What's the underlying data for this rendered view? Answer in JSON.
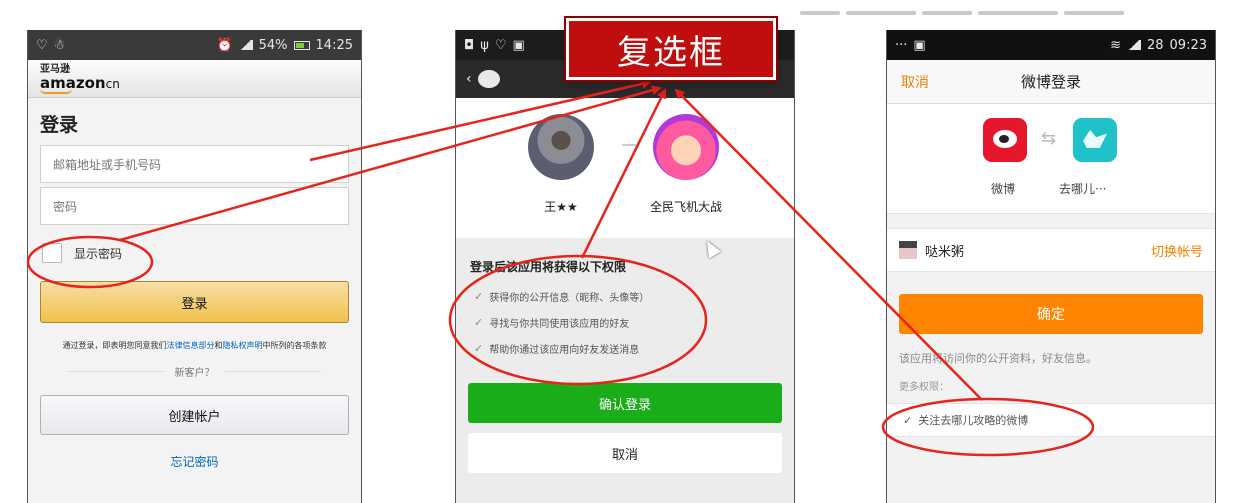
{
  "annotation": {
    "label": "复选框",
    "color": "#d00000"
  },
  "phone1": {
    "status": {
      "time": "14:25",
      "battery": "54%"
    },
    "brand": {
      "cn": "亚马逊",
      "logo": "amazon",
      "logo_suffix": "cn"
    },
    "title": "登录",
    "email_placeholder": "邮箱地址或手机号码",
    "password_placeholder": "密码",
    "show_password": "显示密码",
    "login_button": "登录",
    "terms_before": "通过登录，即表明您同意我们",
    "terms_link1": "法律信息部分",
    "terms_mid": "和",
    "terms_link2": "隐私权声明",
    "terms_after": "中所列的各项条款",
    "new_customer": "新客户？",
    "create_account": "创建帐户",
    "forgot_password": "忘记密码"
  },
  "phone2": {
    "user_name": "王★★",
    "app_name": "全民飞机大战",
    "permissions_title": "登录后该应用将获得以下权限",
    "permissions": [
      "获得你的公开信息（昵称、头像等）",
      "寻找与你共同使用该应用的好友",
      "帮助你通过该应用向好友发送消息"
    ],
    "confirm_button": "确认登录",
    "cancel_button": "取消",
    "accent": "#1aad19"
  },
  "phone3": {
    "status": {
      "time": "09:23",
      "battery": "28"
    },
    "nav_cancel": "取消",
    "nav_title": "微博登录",
    "app1": "微博",
    "app2": "去哪儿···",
    "account_name": "哒米粥",
    "switch_account": "切换帐号",
    "ok_button": "确定",
    "info": "该应用将访问你的公开资料，好友信息。",
    "more_permissions": "更多权限：",
    "follow_option": "关注去哪儿攻略的微博",
    "accent": "#ff8400"
  }
}
